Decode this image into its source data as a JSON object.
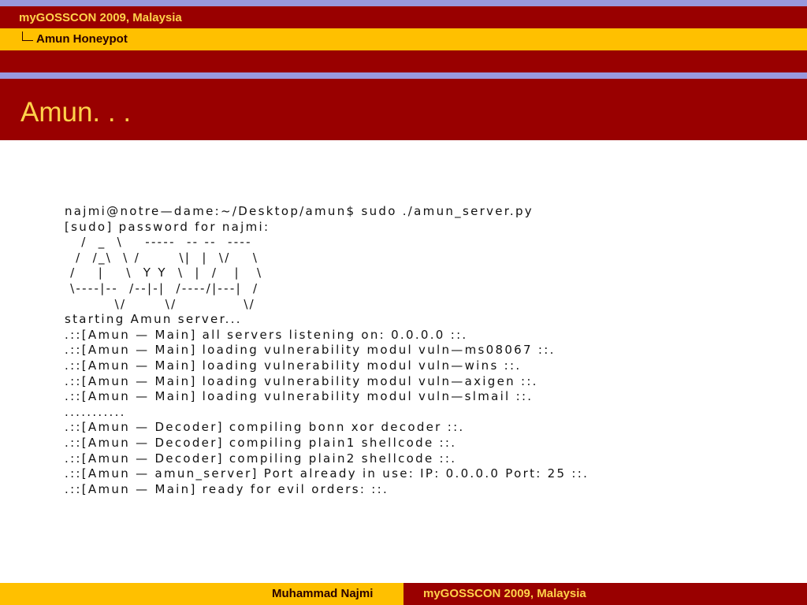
{
  "header": {
    "section": "myGOSSCON 2009, Malaysia",
    "subsection": "Amun Honeypot"
  },
  "frame": {
    "title": "Amun. . ."
  },
  "terminal": {
    "lines": [
      "najmi@notre—dame:~/Desktop/amun$ sudo ./amun_server.py",
      "[sudo] password for najmi:",
      "   /  _  \\    -----  -- --  ----",
      "  /  /_\\  \\ /       \\|  |  \\/    \\",
      " /    |    \\  Y Y  \\  |  /   |   \\",
      " \\----|--  /--|-|  /----/|---|  /",
      "         \\/       \\/            \\/",
      "starting Amun server...",
      ".::[Amun — Main] all servers listening on: 0.0.0.0 ::.",
      ".::[Amun — Main] loading vulnerability modul vuln—ms08067 ::.",
      ".::[Amun — Main] loading vulnerability modul vuln—wins ::.",
      ".::[Amun — Main] loading vulnerability modul vuln—axigen ::.",
      ".::[Amun — Main] loading vulnerability modul vuln—slmail ::.",
      "...........",
      ".::[Amun — Decoder] compiling bonn xor decoder ::.",
      ".::[Amun — Decoder] compiling plain1 shellcode ::.",
      ".::[Amun — Decoder] compiling plain2 shellcode ::.",
      ".::[Amun — amun_server] Port already in use: IP: 0.0.0.0 Port: 25 ::.",
      ".::[Amun — Main] ready for evil orders: ::."
    ]
  },
  "footer": {
    "author": "Muhammad Najmi",
    "event": "myGOSSCON 2009, Malaysia"
  },
  "colors": {
    "dark_red": "#990000",
    "gold": "#ffc000",
    "lavender": "#9999dd",
    "title_text": "#ffd24a"
  }
}
